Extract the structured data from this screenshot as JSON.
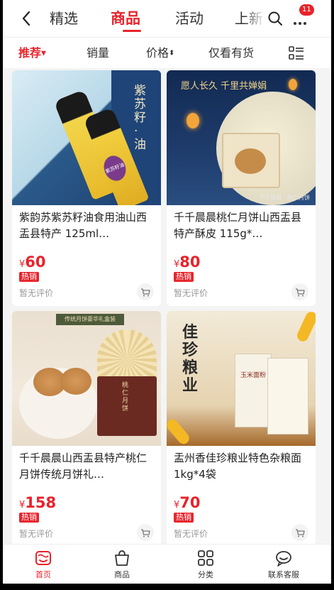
{
  "nav": {
    "back_icon": "chevron-left-icon",
    "tabs": [
      {
        "label": "精选"
      },
      {
        "label": "商品"
      },
      {
        "label": "活动"
      },
      {
        "label": "上新"
      }
    ],
    "active_tab": "商品",
    "search_icon": "search-icon",
    "more_icon": "more-dots-icon",
    "more_badge": "11"
  },
  "filters": {
    "recommend": "推荐",
    "sales": "销量",
    "price": "价格",
    "in_stock": "仅看有货",
    "layout_icon": "list-layout-icon"
  },
  "products": [
    {
      "title": "紫韵苏紫苏籽油食用油山西盂县特产 125ml…",
      "price_symbol": "¥",
      "price": "60",
      "tag": "热销",
      "review": "暂无评价",
      "image_text": "紫苏籽·油",
      "image_label": "紫苏籽油"
    },
    {
      "title": "千千晨晨桃仁月饼山西盂县特产酥皮 115g*…",
      "price_symbol": "¥",
      "price": "80",
      "tag": "热销",
      "review": "暂无评价",
      "image_text": "愿人长久 千里共婵娟",
      "image_label": "千千晨晨 · 桃仁月饼"
    },
    {
      "title": "千千晨晨山西盂县特产桃仁月饼传统月饼礼…",
      "price_symbol": "¥",
      "price": "158",
      "tag": "热销",
      "review": "暂无评价",
      "image_text": "传统月饼豪华礼盒装",
      "image_label": "桃仁月饼"
    },
    {
      "title": "盂州香佳珍粮业特色杂粮面 1kg*4袋",
      "price_symbol": "¥",
      "price": "70",
      "tag": "热销",
      "review": "暂无评价",
      "image_text": "佳珍粮业",
      "image_label": "玉米面粉"
    }
  ],
  "bottom_nav": [
    {
      "label": "首页",
      "icon": "home-icon"
    },
    {
      "label": "商品",
      "icon": "shopping-bag-icon"
    },
    {
      "label": "分类",
      "icon": "category-grid-icon"
    },
    {
      "label": "联系客服",
      "icon": "chat-service-icon"
    }
  ],
  "colors": {
    "accent": "#e8232b",
    "background": "#f4f4f4"
  }
}
